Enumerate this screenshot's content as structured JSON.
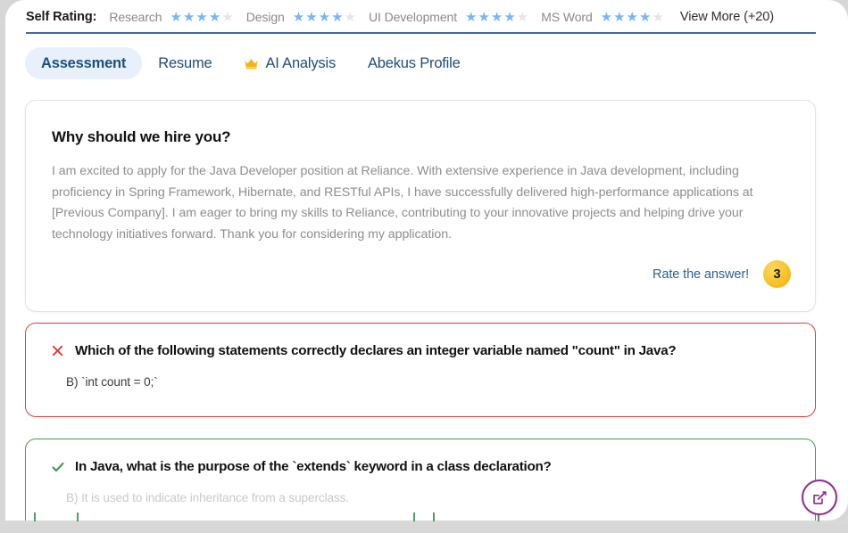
{
  "self_rating": {
    "label": "Self Rating:",
    "skills": [
      {
        "name": "Research",
        "stars": 4,
        "max": 5
      },
      {
        "name": "Design",
        "stars": 4,
        "max": 5
      },
      {
        "name": "UI Development",
        "stars": 4,
        "max": 5
      },
      {
        "name": "MS Word",
        "stars": 4,
        "max": 5
      }
    ],
    "view_more": "View More (+20)",
    "star_filled_color": "#7ab6f5",
    "star_empty_color": "#e6e6e6",
    "divider_color": "#41689c"
  },
  "tabs": [
    {
      "label": "Assessment",
      "active": true,
      "icon": ""
    },
    {
      "label": "Resume",
      "active": false,
      "icon": ""
    },
    {
      "label": "AI Analysis",
      "active": false,
      "icon": "crown-icon"
    },
    {
      "label": "Abekus Profile",
      "active": false,
      "icon": ""
    }
  ],
  "answer_card": {
    "title": "Why should we hire you?",
    "body": "I am excited to apply for the Java Developer position at Reliance. With extensive experience in Java development, including proficiency in Spring Framework, Hibernate, and RESTful APIs, I have successfully delivered high-performance applications at [Previous Company]. I am eager to bring my skills to Reliance, contributing to your innovative projects and helping drive your technology initiatives forward. Thank you for considering my application.",
    "rate_label": "Rate the answer!",
    "rate_value": "3",
    "rate_badge_color": "#f5bc1e"
  },
  "questions": [
    {
      "status": "incorrect",
      "status_icon": "cross-icon",
      "accent_color": "#e23c3c",
      "question": "Which of the following statements correctly declares an integer variable named \"count\" in Java?",
      "answer": "B) `int count = 0;`"
    },
    {
      "status": "correct",
      "status_icon": "check-icon",
      "accent_color": "#3f9c5c",
      "question": "In Java, what is the purpose of the `extends` keyword in a class declaration?",
      "answer": "B) It is used to indicate inheritance from a superclass."
    }
  ],
  "fab": {
    "icon": "edit-compose-icon",
    "color": "#8b2f8b"
  }
}
